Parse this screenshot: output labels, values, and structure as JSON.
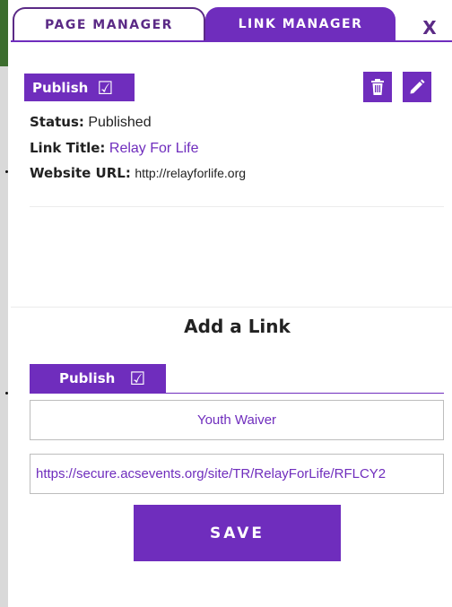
{
  "tabs": [
    {
      "label": "PAGE MANAGER"
    },
    {
      "label": "LINK MANAGER"
    }
  ],
  "close_label": "X",
  "accent_color": "#6f2dbd",
  "existing_link": {
    "publish_label": "Publish",
    "publish_checked": true,
    "status_label": "Status:",
    "status_value": "Published",
    "title_label": "Link Title:",
    "title_value": "Relay For Life",
    "url_label": "Website URL:",
    "url_value": "http://relayforlife.org",
    "actions": {
      "delete_icon": "trash-icon",
      "edit_icon": "pencil-icon"
    }
  },
  "add_link": {
    "heading": "Add a Link",
    "publish_label": "Publish",
    "publish_checked": true,
    "title_value": "Youth Waiver",
    "url_value": "https://secure.acsevents.org/site/TR/RelayForLife/RFLCY2",
    "save_label": "SAVE"
  }
}
